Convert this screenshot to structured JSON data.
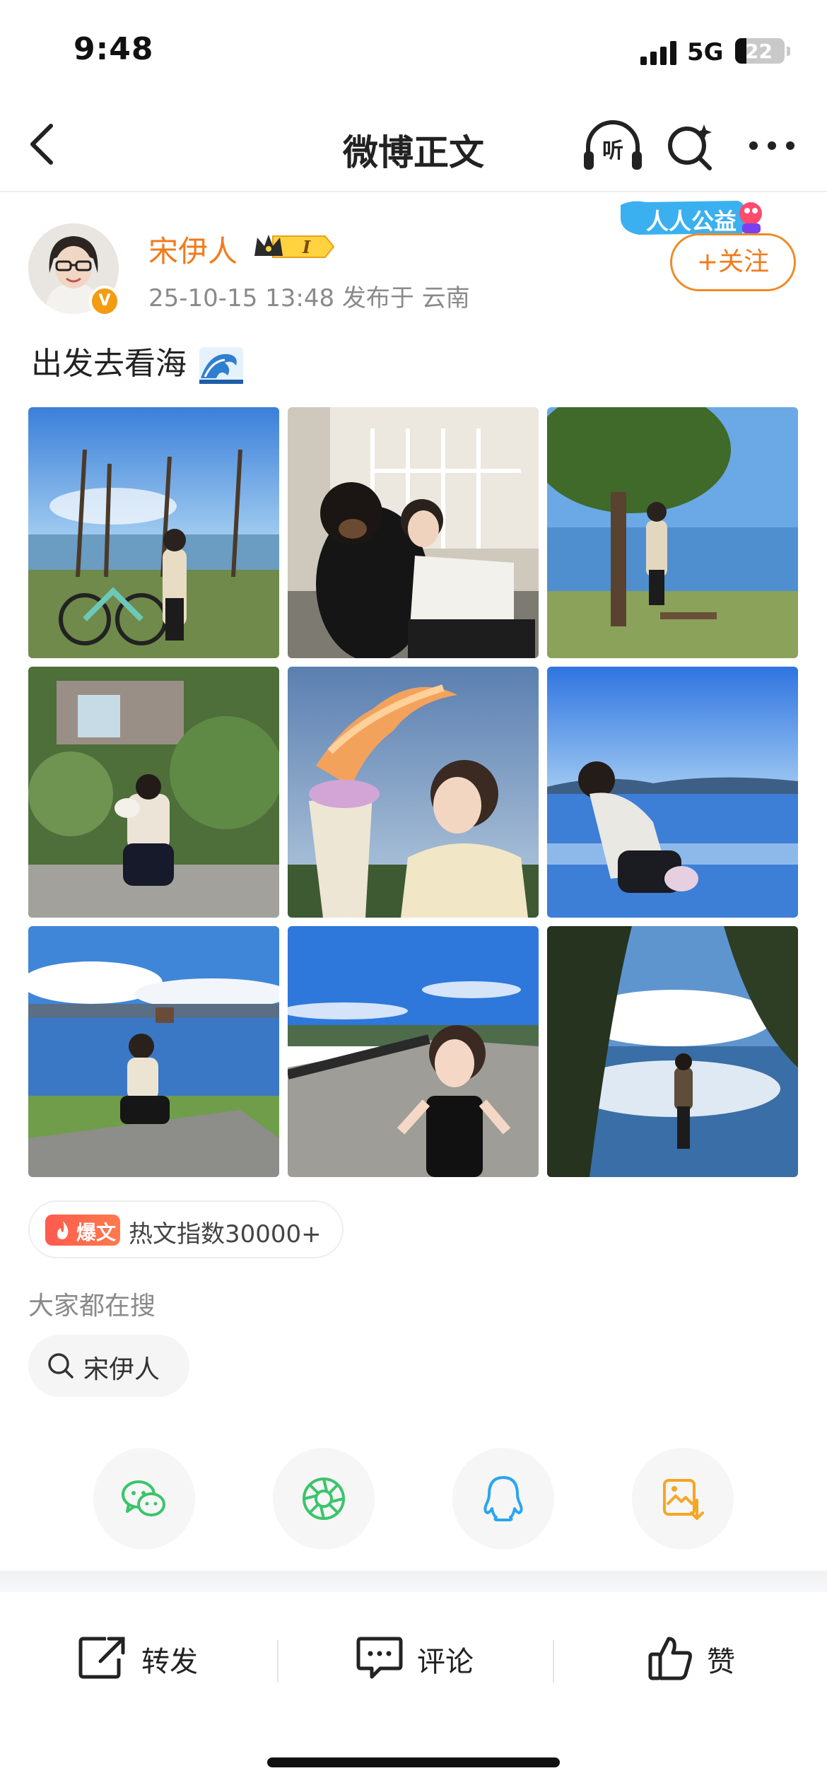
{
  "status_bar": {
    "time": "9:48",
    "network": "5G",
    "battery": "22"
  },
  "nav": {
    "title": "微博正文",
    "listen_label": "听",
    "back_icon": "chevron-left-icon",
    "search_icon": "ai-search-icon",
    "more_icon": "more-dots-icon"
  },
  "post": {
    "username": "宋伊人",
    "level_badge": "I",
    "timestamp": "25-10-15 13:48  发布于 云南",
    "follow_label": "+关注",
    "charity_label": "人人公益",
    "text": "出发去看海",
    "verified_mark": "V",
    "photos": [
      {
        "desc": "bicycles by lake with trees"
      },
      {
        "desc": "woman with large black dog"
      },
      {
        "desc": "woman under tree by lake"
      },
      {
        "desc": "woman crouching by flowers"
      },
      {
        "desc": "woman holding flowers at sunset"
      },
      {
        "desc": "woman crouching by blue lake"
      },
      {
        "desc": "woman sitting on pier"
      },
      {
        "desc": "woman smiling on path"
      },
      {
        "desc": "woman standing by reflecting lake"
      }
    ]
  },
  "hot": {
    "tag": "爆文",
    "text": "热文指数30000+"
  },
  "search": {
    "heading": "大家都在搜",
    "chip": "宋伊人"
  },
  "share": {
    "wechat_icon": "wechat-icon",
    "moments_icon": "moments-icon",
    "qq_icon": "qq-icon",
    "save_image_icon": "save-image-icon"
  },
  "actions": {
    "repost": "转发",
    "comment": "评论",
    "like": "赞"
  },
  "colors": {
    "accent": "#f07b1d",
    "hot_red": "#ff5a4e",
    "wechat_green": "#3cc46b",
    "qq_blue": "#2aa5ef",
    "save_orange": "#f5a623"
  }
}
